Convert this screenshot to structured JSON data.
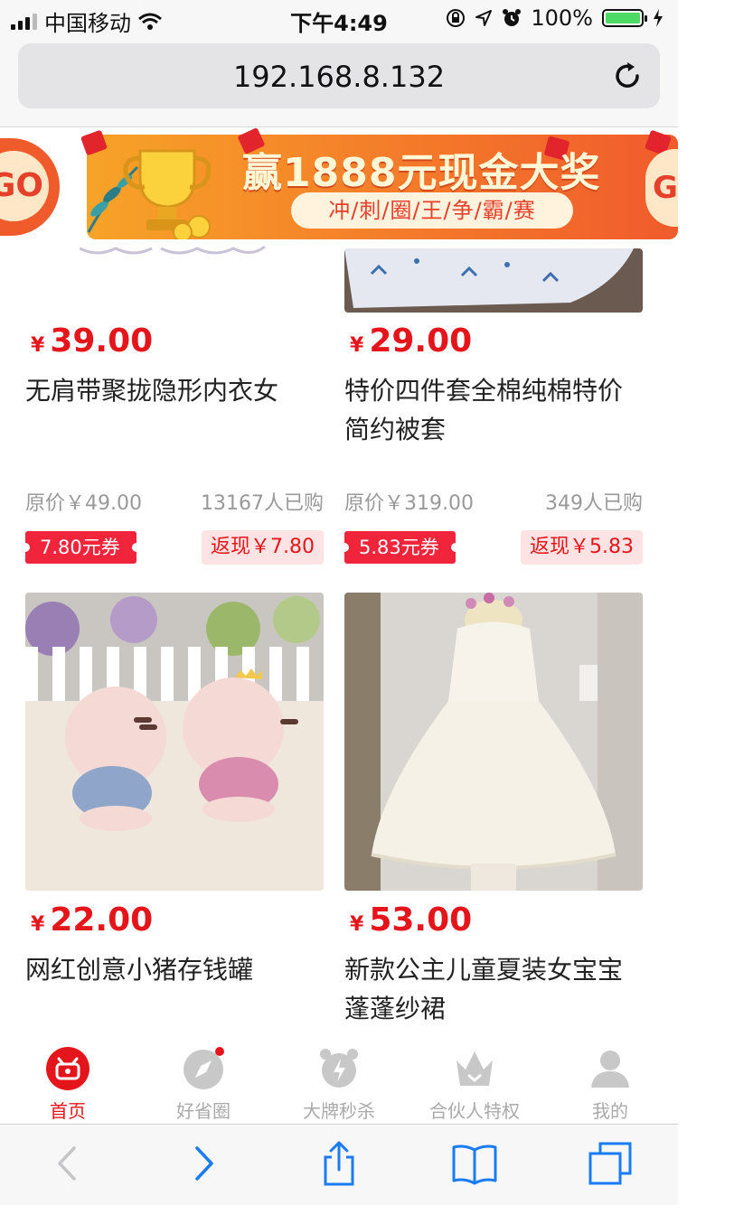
{
  "status_bar": {
    "carrier": "中国移动",
    "time": "下午4:49",
    "battery_text": "100%",
    "battery_level": 1.0
  },
  "browser": {
    "url": "192.168.8.132"
  },
  "banner": {
    "left_badge": "GO",
    "right_badge": "GO",
    "title": "赢1888元现金大奖",
    "subtitle": "冲/刺/圈/王/争/霸/赛"
  },
  "products": [
    {
      "price_symbol": "¥",
      "price": "39.00",
      "title": "无肩带聚拢隐形内衣女",
      "original_price": "原价￥49.00",
      "sold": "13167人已购",
      "coupon": "7.80元券",
      "cashback": "返现￥7.80"
    },
    {
      "price_symbol": "¥",
      "price": "29.00",
      "title": "特价四件套全棉纯棉特价简约被套",
      "original_price": "原价￥319.00",
      "sold": "349人已购",
      "coupon": "5.83元券",
      "cashback": "返现￥5.83"
    },
    {
      "price_symbol": "¥",
      "price": "22.00",
      "title": "网红创意小猪存钱罐"
    },
    {
      "price_symbol": "¥",
      "price": "53.00",
      "title": "新款公主儿童夏装女宝宝蓬蓬纱裙"
    }
  ],
  "tabbar": {
    "items": [
      {
        "label": "首页",
        "icon": "home-icon",
        "active": true
      },
      {
        "label": "好省圈",
        "icon": "compass-icon",
        "active": false
      },
      {
        "label": "大牌秒杀",
        "icon": "alarm-clock-icon",
        "active": false
      },
      {
        "label": "合伙人特权",
        "icon": "crown-icon",
        "active": false
      },
      {
        "label": "我的",
        "icon": "user-icon",
        "active": false
      }
    ]
  },
  "colors": {
    "accent": "#e5161b",
    "coupon": "#f0243a",
    "cashback_bg": "#fde3e3",
    "ios_blue": "#1a7cf5"
  }
}
